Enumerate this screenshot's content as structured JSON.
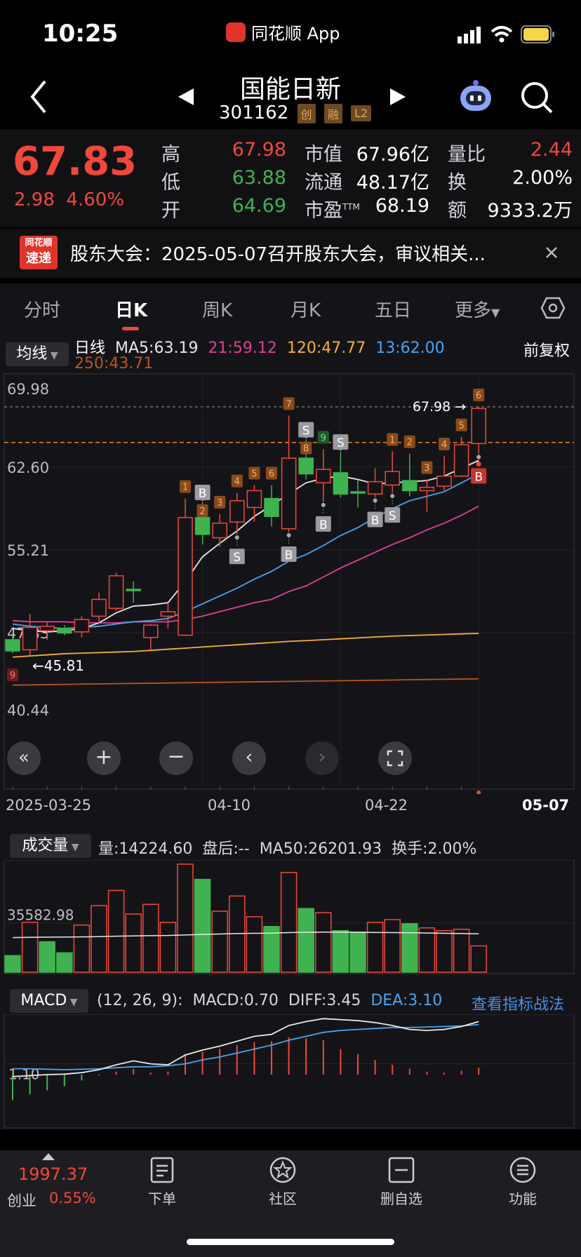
{
  "status_bar": {
    "time": "10:25",
    "app_name": "同花顺 App"
  },
  "nav": {
    "title": "国能日新",
    "code": "301162",
    "badges": [
      "创",
      "融",
      "L2"
    ]
  },
  "quote": {
    "price": "67.83",
    "change": "2.98",
    "change_pct": "4.60%",
    "stats": [
      {
        "label": "高",
        "value": "67.98",
        "tone": "red"
      },
      {
        "label": "低",
        "value": "63.88",
        "tone": "green"
      },
      {
        "label": "开",
        "value": "64.69",
        "tone": "green"
      }
    ],
    "market": [
      {
        "label": "市值",
        "value": "67.96亿"
      },
      {
        "label": "流通",
        "value": "48.17亿"
      },
      {
        "label": "市盈",
        "sup": "TTM",
        "value": "68.19"
      }
    ],
    "extra": [
      {
        "label": "量比",
        "value": "2.44",
        "tone": "red"
      },
      {
        "label": "换",
        "value": "2.00%"
      },
      {
        "label": "额",
        "value": "9333.2万"
      }
    ]
  },
  "news": {
    "logo_line1": "同花顺",
    "logo_line2": "速递",
    "text": "股东大会：2025-05-07召开股东大会，审议相关..."
  },
  "tabs": [
    "分时",
    "日K",
    "周K",
    "月K",
    "五日",
    "更多"
  ],
  "active_tab": "日K",
  "ma_bar": {
    "selector": "均线",
    "label": "日线",
    "ma5": "MA5:63.19",
    "ma21": "21:59.12",
    "ma120": "120:47.77",
    "ma13": "13:62.00",
    "ma250": "250:43.71",
    "adjust": "前复权"
  },
  "price_chart": {
    "y_ticks": [
      "69.98",
      "62.60",
      "55.21",
      "47.83",
      "40.44"
    ],
    "high_label": "67.98",
    "low_label": "←45.81",
    "dates": [
      "2025-03-25",
      "04-10",
      "04-22",
      "05-07"
    ],
    "colors": {
      "up": "#f0483c",
      "down": "#3fb34f",
      "ma5": "#e8e8e8",
      "ma13": "#4aa3f0",
      "ma21": "#e0409a",
      "ma120": "#f2b134",
      "ma250": "#b8551e"
    },
    "candles": [
      {
        "o": 47.2,
        "h": 47.6,
        "l": 46.0,
        "c": 46.2
      },
      {
        "o": 46.3,
        "h": 49.5,
        "l": 45.8,
        "c": 48.3
      },
      {
        "o": 48.0,
        "h": 48.8,
        "l": 47.2,
        "c": 48.4
      },
      {
        "o": 48.2,
        "h": 48.5,
        "l": 47.6,
        "c": 47.8
      },
      {
        "o": 47.9,
        "h": 49.3,
        "l": 47.4,
        "c": 49.0
      },
      {
        "o": 49.3,
        "h": 51.4,
        "l": 48.6,
        "c": 50.8
      },
      {
        "o": 50.0,
        "h": 53.2,
        "l": 49.8,
        "c": 52.9
      },
      {
        "o": 51.7,
        "h": 52.4,
        "l": 50.5,
        "c": 51.6
      },
      {
        "o": 47.4,
        "h": 48.6,
        "l": 46.3,
        "c": 48.5
      },
      {
        "o": 49.3,
        "h": 50.4,
        "l": 48.2,
        "c": 49.7
      },
      {
        "o": 47.6,
        "h": 59.8,
        "l": 47.6,
        "c": 58.1
      },
      {
        "o": 58.1,
        "h": 59.4,
        "l": 55.7,
        "c": 56.6
      },
      {
        "o": 56.3,
        "h": 58.4,
        "l": 55.5,
        "c": 57.6
      },
      {
        "o": 57.7,
        "h": 60.3,
        "l": 56.7,
        "c": 59.6
      },
      {
        "o": 59.0,
        "h": 61.0,
        "l": 57.7,
        "c": 60.5
      },
      {
        "o": 59.8,
        "h": 61.0,
        "l": 57.3,
        "c": 58.2
      },
      {
        "o": 57.1,
        "h": 67.2,
        "l": 56.9,
        "c": 63.4
      },
      {
        "o": 63.4,
        "h": 65.0,
        "l": 61.5,
        "c": 62.0
      },
      {
        "o": 61.2,
        "h": 64.2,
        "l": 59.6,
        "c": 62.4
      },
      {
        "o": 62.1,
        "h": 63.9,
        "l": 59.9,
        "c": 60.2
      },
      {
        "o": 60.4,
        "h": 61.5,
        "l": 59.0,
        "c": 60.3
      },
      {
        "o": 60.2,
        "h": 62.5,
        "l": 60.0,
        "c": 61.3
      },
      {
        "o": 61.0,
        "h": 64.0,
        "l": 60.4,
        "c": 62.2
      },
      {
        "o": 61.4,
        "h": 63.8,
        "l": 60.0,
        "c": 60.5
      },
      {
        "o": 60.5,
        "h": 61.5,
        "l": 58.6,
        "c": 60.8
      },
      {
        "o": 60.9,
        "h": 63.6,
        "l": 60.5,
        "c": 61.8
      },
      {
        "o": 61.8,
        "h": 65.3,
        "l": 61.7,
        "c": 64.6
      },
      {
        "o": 64.7,
        "h": 67.98,
        "l": 63.88,
        "c": 67.83
      }
    ],
    "ma5": [
      48.2,
      48.0,
      47.9,
      48.0,
      48.2,
      48.7,
      49.6,
      50.2,
      50.3,
      50.5,
      52.4,
      54.6,
      55.8,
      56.9,
      58.2,
      59.2,
      60.2,
      61.2,
      61.6,
      61.8,
      61.5,
      61.1,
      61.2,
      61.3,
      61.4,
      61.8,
      62.5,
      63.19
    ],
    "ma13": [
      48.6,
      48.4,
      48.3,
      48.2,
      48.3,
      48.4,
      48.6,
      48.8,
      48.9,
      49.1,
      49.7,
      50.4,
      51.1,
      51.8,
      52.6,
      53.3,
      54.2,
      54.8,
      55.6,
      56.5,
      57.2,
      58.1,
      58.9,
      59.6,
      60.0,
      60.4,
      61.2,
      62.0
    ],
    "ma21": [
      48.9,
      48.8,
      48.8,
      48.8,
      48.7,
      48.7,
      48.7,
      48.8,
      48.8,
      48.8,
      49.0,
      49.3,
      49.7,
      50.1,
      50.5,
      50.8,
      51.5,
      52.0,
      52.8,
      53.6,
      54.3,
      55.0,
      55.7,
      56.3,
      57.0,
      57.6,
      58.3,
      59.12
    ],
    "ma120": [
      45.65,
      45.75,
      45.85,
      45.95,
      46.0,
      46.05,
      46.1,
      46.15,
      46.25,
      46.35,
      46.45,
      46.55,
      46.65,
      46.75,
      46.85,
      46.95,
      47.05,
      47.12,
      47.2,
      47.28,
      47.36,
      47.44,
      47.52,
      47.57,
      47.62,
      47.67,
      47.72,
      47.77
    ],
    "ma250": [
      43.15,
      43.17,
      43.19,
      43.21,
      43.24,
      43.26,
      43.28,
      43.3,
      43.32,
      43.34,
      43.36,
      43.38,
      43.4,
      43.42,
      43.44,
      43.46,
      43.48,
      43.5,
      43.52,
      43.54,
      43.56,
      43.58,
      43.6,
      43.63,
      43.65,
      43.67,
      43.69,
      43.71
    ],
    "markers": [
      {
        "i": 0,
        "t": "9",
        "kind": "num-red",
        "pos": "below"
      },
      {
        "i": 10,
        "t": "1",
        "kind": "num",
        "pos": "above"
      },
      {
        "i": 11,
        "t": "B",
        "kind": "B",
        "pos": "above"
      },
      {
        "i": 11,
        "t": "2",
        "kind": "num",
        "pos": "above2"
      },
      {
        "i": 12,
        "t": "3",
        "kind": "num",
        "pos": "above"
      },
      {
        "i": 13,
        "t": "4",
        "kind": "num",
        "pos": "above"
      },
      {
        "i": 13,
        "t": "S",
        "kind": "S",
        "pos": "below"
      },
      {
        "i": 14,
        "t": "5",
        "kind": "num",
        "pos": "above"
      },
      {
        "i": 15,
        "t": "6",
        "kind": "num",
        "pos": "above"
      },
      {
        "i": 16,
        "t": "7",
        "kind": "num",
        "pos": "above"
      },
      {
        "i": 16,
        "t": "B",
        "kind": "B",
        "pos": "below"
      },
      {
        "i": 17,
        "t": "S",
        "kind": "S",
        "pos": "above"
      },
      {
        "i": 17,
        "t": "8",
        "kind": "num",
        "pos": "above2"
      },
      {
        "i": 18,
        "t": "9",
        "kind": "num-green",
        "pos": "above"
      },
      {
        "i": 18,
        "t": "B",
        "kind": "B",
        "pos": "below"
      },
      {
        "i": 19,
        "t": "S",
        "kind": "S",
        "pos": "above"
      },
      {
        "i": 21,
        "t": "B",
        "kind": "B",
        "pos": "below"
      },
      {
        "i": 22,
        "t": "1",
        "kind": "num",
        "pos": "above"
      },
      {
        "i": 22,
        "t": "S",
        "kind": "S",
        "pos": "below"
      },
      {
        "i": 23,
        "t": "2",
        "kind": "num",
        "pos": "above"
      },
      {
        "i": 24,
        "t": "3",
        "kind": "num",
        "pos": "above"
      },
      {
        "i": 25,
        "t": "4",
        "kind": "num",
        "pos": "above"
      },
      {
        "i": 26,
        "t": "5",
        "kind": "num",
        "pos": "above"
      },
      {
        "i": 27,
        "t": "6",
        "kind": "num",
        "pos": "above"
      },
      {
        "i": 27,
        "t": "B",
        "kind": "B-red",
        "pos": "below"
      }
    ]
  },
  "volume": {
    "selector": "成交量",
    "vol": "量:14224.60",
    "after": "盘后:--",
    "ma50": "MA50:26201.93",
    "turnover": "换手:2.00%",
    "y_tick": "35582.98",
    "bars": [
      {
        "v": 12000,
        "up": false
      },
      {
        "v": 36000,
        "up": true
      },
      {
        "v": 22000,
        "up": false
      },
      {
        "v": 14000,
        "up": false
      },
      {
        "v": 34000,
        "up": true
      },
      {
        "v": 48000,
        "up": true
      },
      {
        "v": 59000,
        "up": true
      },
      {
        "v": 42000,
        "up": true
      },
      {
        "v": 49000,
        "up": true
      },
      {
        "v": 36000,
        "up": true
      },
      {
        "v": 78000,
        "up": true
      },
      {
        "v": 67000,
        "up": false
      },
      {
        "v": 44000,
        "up": true
      },
      {
        "v": 55000,
        "up": true
      },
      {
        "v": 40000,
        "up": true
      },
      {
        "v": 33000,
        "up": false
      },
      {
        "v": 72000,
        "up": true
      },
      {
        "v": 46000,
        "up": false
      },
      {
        "v": 43000,
        "up": true
      },
      {
        "v": 30000,
        "up": false
      },
      {
        "v": 29000,
        "up": false
      },
      {
        "v": 36000,
        "up": true
      },
      {
        "v": 38000,
        "up": true
      },
      {
        "v": 35000,
        "up": false
      },
      {
        "v": 32000,
        "up": true
      },
      {
        "v": 30000,
        "up": true
      },
      {
        "v": 31000,
        "up": true
      },
      {
        "v": 19000,
        "up": true
      }
    ],
    "ma": [
      25000,
      25200,
      25300,
      25400,
      25500,
      25700,
      26000,
      26200,
      26400,
      26500,
      26900,
      27300,
      27600,
      27900,
      28100,
      28200,
      28600,
      28800,
      28900,
      28900,
      28800,
      28700,
      28600,
      28500,
      28300,
      28100,
      27900,
      27700
    ]
  },
  "macd": {
    "selector": "MACD",
    "params": "(12, 26, 9):",
    "macd": "MACD:0.70",
    "diff": "DIFF:3.45",
    "dea": "DEA:3.10",
    "link": "查看指标战法",
    "y_tick": "1.10",
    "hist": [
      -2.6,
      -2.0,
      -1.6,
      -1.2,
      -0.6,
      -0.1,
      0.3,
      0.6,
      0.2,
      0.3,
      2.1,
      2.3,
      2.6,
      3.0,
      3.3,
      3.4,
      3.8,
      3.7,
      3.5,
      2.6,
      2.1,
      1.5,
      1.0,
      0.6,
      0.3,
      0.2,
      0.4,
      0.7
    ],
    "diff_line": [
      -0.2,
      -0.1,
      0.0,
      0.05,
      0.2,
      0.5,
      1.0,
      1.4,
      1.1,
      1.0,
      2.0,
      2.5,
      2.9,
      3.4,
      3.9,
      4.1,
      5.0,
      5.4,
      5.7,
      5.6,
      5.5,
      5.3,
      5.0,
      4.6,
      4.5,
      4.6,
      4.9,
      5.4
    ],
    "dea_line": [
      0.6,
      0.6,
      0.55,
      0.5,
      0.55,
      0.6,
      0.7,
      0.8,
      0.8,
      0.9,
      1.1,
      1.5,
      1.8,
      2.2,
      2.6,
      3.0,
      3.5,
      3.9,
      4.3,
      4.5,
      4.6,
      4.7,
      4.8,
      4.8,
      4.85,
      4.9,
      4.95,
      5.1
    ]
  },
  "bottom_bar": {
    "index_value": "1997.37",
    "index_name": "创业",
    "index_pct": "0.55%",
    "items": [
      "下单",
      "社区",
      "删自选",
      "功能"
    ]
  }
}
